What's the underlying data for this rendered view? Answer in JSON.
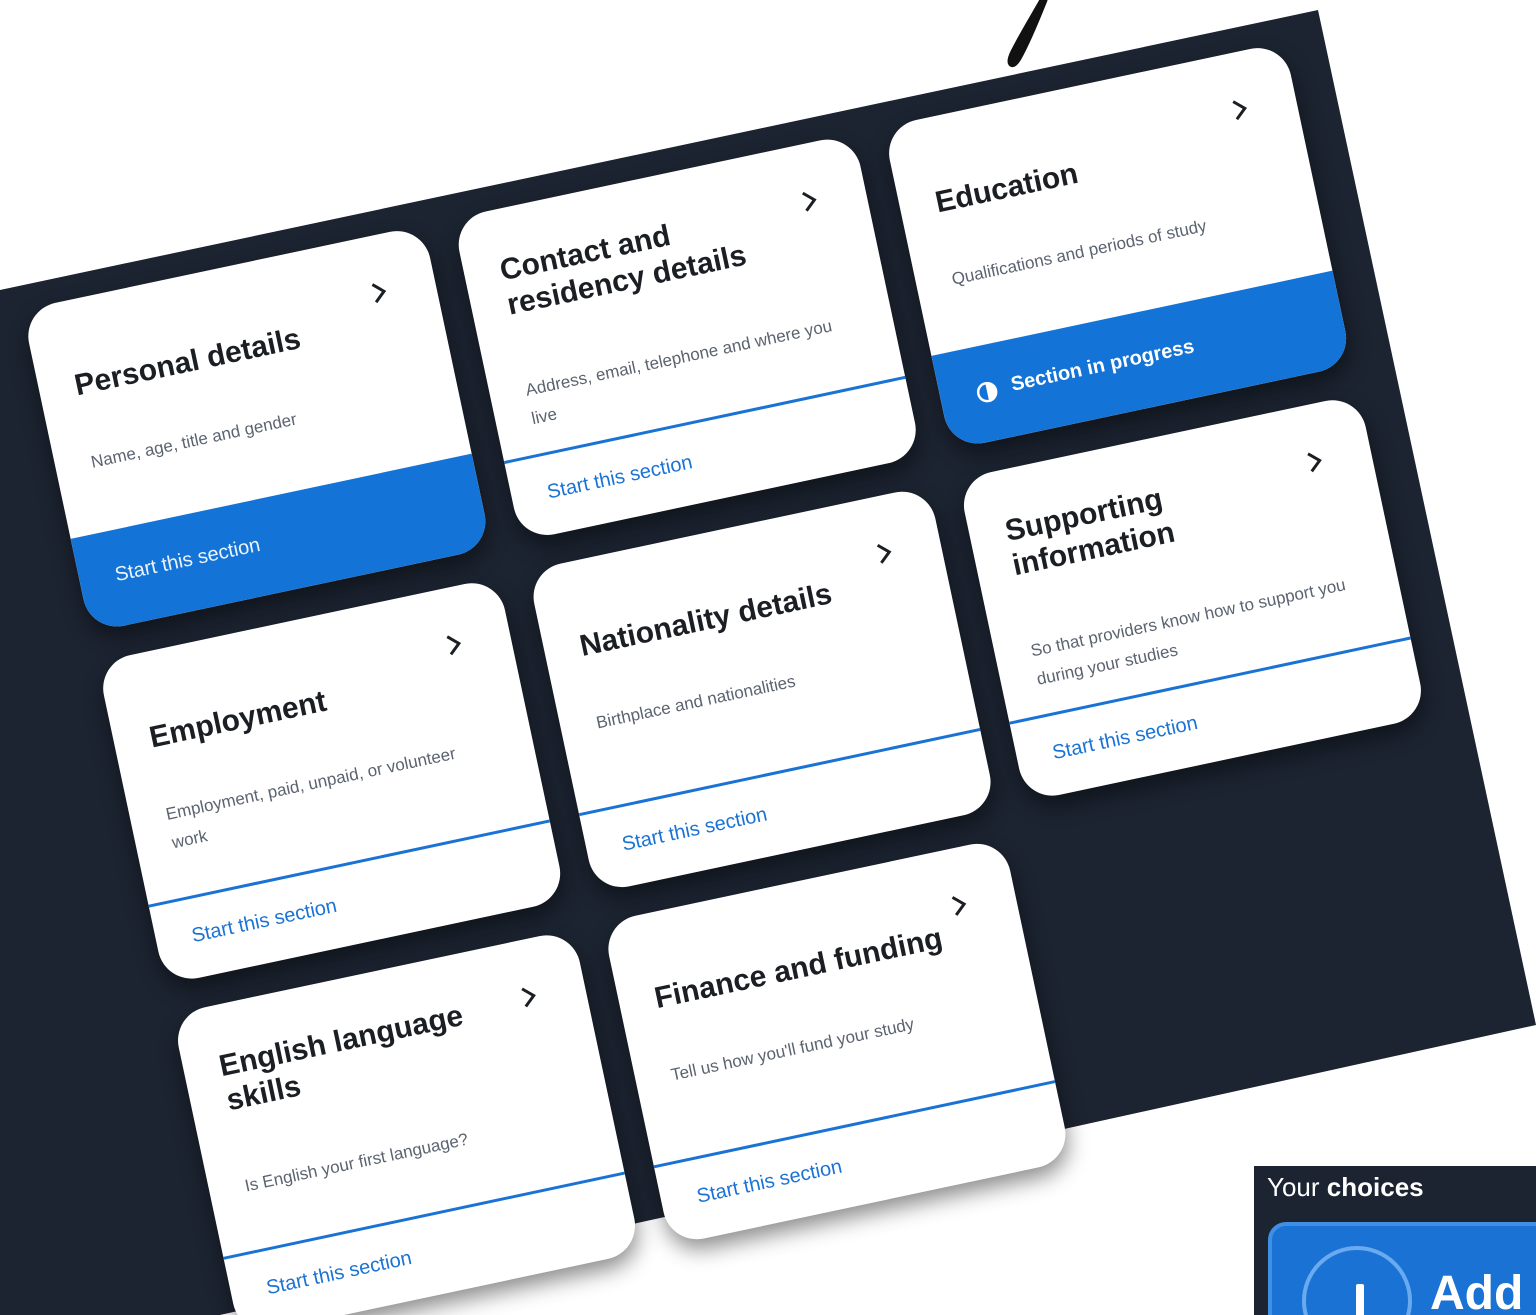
{
  "colors": {
    "background_dark": "#1c2431",
    "accent_blue": "#1a73d4",
    "card_bg": "#ffffff",
    "title_text": "#1b1f24",
    "desc_text": "#5b6370"
  },
  "icons": {
    "chevron": "chevron-right-icon",
    "progress": "half-circle-icon",
    "plus": "plus-icon"
  },
  "cards": [
    {
      "title": "Personal details",
      "description": "Name, age, title and gender",
      "status": "Start this section"
    },
    {
      "title": "Contact and residency details",
      "description": "Address, email, telephone and where you live",
      "status": "Start this section"
    },
    {
      "title": "Education",
      "description": "Qualifications and periods of study",
      "status": "Section in progress"
    },
    {
      "title": "Employment",
      "description": "Employment, paid, unpaid, or volunteer work",
      "status": "Start this section"
    },
    {
      "title": "Nationality details",
      "description": "Birthplace and nationalities",
      "status": "Start this section"
    },
    {
      "title": "Supporting information",
      "description": "So that providers know how to support you during your studies",
      "status": "Start this section"
    },
    {
      "title": "English language skills",
      "description": "Is English your first language?",
      "status": "Start this section"
    },
    {
      "title": "Finance and funding",
      "description": "Tell us how you'll fund your study",
      "status": "Start this section"
    }
  ],
  "choices": {
    "heading_prefix": "Your",
    "heading_bold": "choices",
    "add_label": "Add"
  }
}
